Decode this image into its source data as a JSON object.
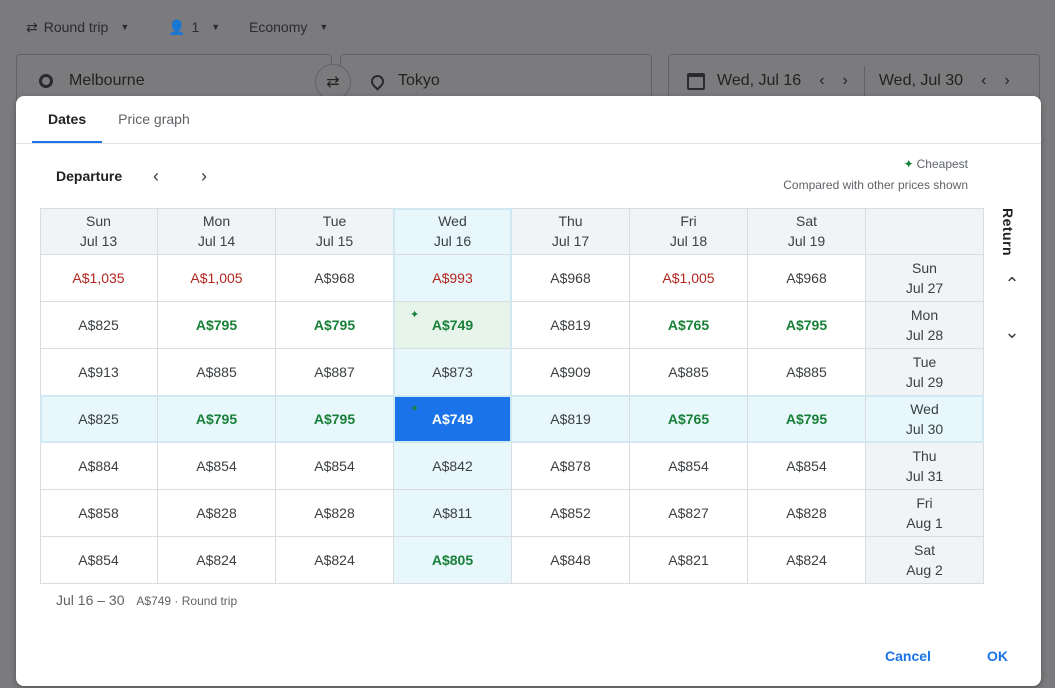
{
  "search": {
    "trip_type": "Round trip",
    "passengers": "1",
    "cabin": "Economy",
    "origin": "Melbourne",
    "destination": "Tokyo",
    "depart_date": "Wed, Jul 16",
    "return_date": "Wed, Jul 30"
  },
  "dialog": {
    "tabs": [
      "Dates",
      "Price graph"
    ],
    "departure_label": "Departure",
    "return_label": "Return",
    "cheapest_label": "Cheapest",
    "compared_text": "Compared with other prices shown",
    "departure_columns": [
      {
        "day": "Sun",
        "date": "Jul 13"
      },
      {
        "day": "Mon",
        "date": "Jul 14"
      },
      {
        "day": "Tue",
        "date": "Jul 15"
      },
      {
        "day": "Wed",
        "date": "Jul 16"
      },
      {
        "day": "Thu",
        "date": "Jul 17"
      },
      {
        "day": "Fri",
        "date": "Jul 18"
      },
      {
        "day": "Sat",
        "date": "Jul 19"
      }
    ],
    "return_rows": [
      {
        "day": "Sun",
        "date": "Jul 27",
        "prices": [
          {
            "v": "A$1,035",
            "s": "high"
          },
          {
            "v": "A$1,005",
            "s": "high"
          },
          {
            "v": "A$968",
            "s": ""
          },
          {
            "v": "A$993",
            "s": "high"
          },
          {
            "v": "A$968",
            "s": ""
          },
          {
            "v": "A$1,005",
            "s": "high"
          },
          {
            "v": "A$968",
            "s": ""
          }
        ]
      },
      {
        "day": "Mon",
        "date": "Jul 28",
        "prices": [
          {
            "v": "A$825",
            "s": ""
          },
          {
            "v": "A$795",
            "s": "low"
          },
          {
            "v": "A$795",
            "s": "low"
          },
          {
            "v": "A$749",
            "s": "low",
            "cheapest": true
          },
          {
            "v": "A$819",
            "s": ""
          },
          {
            "v": "A$765",
            "s": "low"
          },
          {
            "v": "A$795",
            "s": "low"
          }
        ]
      },
      {
        "day": "Tue",
        "date": "Jul 29",
        "prices": [
          {
            "v": "A$913",
            "s": ""
          },
          {
            "v": "A$885",
            "s": ""
          },
          {
            "v": "A$887",
            "s": ""
          },
          {
            "v": "A$873",
            "s": ""
          },
          {
            "v": "A$909",
            "s": ""
          },
          {
            "v": "A$885",
            "s": ""
          },
          {
            "v": "A$885",
            "s": ""
          }
        ]
      },
      {
        "day": "Wed",
        "date": "Jul 30",
        "prices": [
          {
            "v": "A$825",
            "s": ""
          },
          {
            "v": "A$795",
            "s": "low"
          },
          {
            "v": "A$795",
            "s": "low"
          },
          {
            "v": "A$749",
            "s": "low",
            "cheapest": true,
            "selected": true
          },
          {
            "v": "A$819",
            "s": ""
          },
          {
            "v": "A$765",
            "s": "low"
          },
          {
            "v": "A$795",
            "s": "low"
          }
        ]
      },
      {
        "day": "Thu",
        "date": "Jul 31",
        "prices": [
          {
            "v": "A$884",
            "s": ""
          },
          {
            "v": "A$854",
            "s": ""
          },
          {
            "v": "A$854",
            "s": ""
          },
          {
            "v": "A$842",
            "s": ""
          },
          {
            "v": "A$878",
            "s": ""
          },
          {
            "v": "A$854",
            "s": ""
          },
          {
            "v": "A$854",
            "s": ""
          }
        ]
      },
      {
        "day": "Fri",
        "date": "Aug 1",
        "prices": [
          {
            "v": "A$858",
            "s": ""
          },
          {
            "v": "A$828",
            "s": ""
          },
          {
            "v": "A$828",
            "s": ""
          },
          {
            "v": "A$811",
            "s": ""
          },
          {
            "v": "A$852",
            "s": ""
          },
          {
            "v": "A$827",
            "s": ""
          },
          {
            "v": "A$828",
            "s": ""
          }
        ]
      },
      {
        "day": "Sat",
        "date": "Aug 2",
        "prices": [
          {
            "v": "A$854",
            "s": ""
          },
          {
            "v": "A$824",
            "s": ""
          },
          {
            "v": "A$824",
            "s": ""
          },
          {
            "v": "A$805",
            "s": "low"
          },
          {
            "v": "A$848",
            "s": ""
          },
          {
            "v": "A$821",
            "s": ""
          },
          {
            "v": "A$824",
            "s": ""
          }
        ]
      }
    ],
    "summary_dates": "Jul 16 – 30",
    "summary_price": "A$749 · Round trip",
    "cancel_label": "Cancel",
    "ok_label": "OK"
  },
  "colors": {
    "accent": "#1a73e8",
    "low": "#188038",
    "high": "#b3261e",
    "highlight": "#e8f7fb"
  }
}
